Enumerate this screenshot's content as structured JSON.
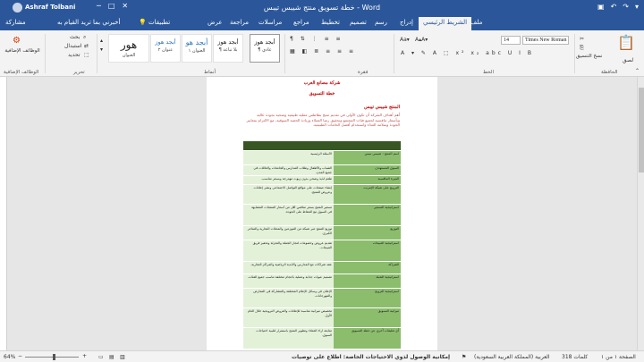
{
  "window": {
    "title": "خطة تسويق منتج شيبس تيبس - Word",
    "user": "Ashraf Tolbani",
    "share_label": "مشاركة",
    "tell_me": "أخبرني بما تريد القيام به"
  },
  "tabs": [
    "ملف",
    "الشريط الرئيسي",
    "إدراج",
    "رسم",
    "تصميم",
    "تخطيط",
    "مراجع",
    "مراسلات",
    "مراجعة",
    "عرض",
    "تطبيقات"
  ],
  "ribbon": {
    "clipboard": {
      "paste_label": "لصق",
      "format_painter": "نسخ التنسيق",
      "group_label": "الحافظة"
    },
    "font": {
      "name": "Times New Roman",
      "size": "14",
      "group_label": "الخط"
    },
    "paragraph": {
      "group_label": "فقرة"
    },
    "styles": {
      "group_label": "أنماط",
      "items": [
        {
          "sample": "أبجد هوز",
          "label": "¶ عادي"
        },
        {
          "sample": "أبجد هوز",
          "label": "¶ بلا تباعد"
        },
        {
          "sample": "أبجد هو",
          "label": "العنوان ١"
        },
        {
          "sample": "أبجد هوز",
          "label": "عنوان ٢"
        },
        {
          "sample": "هور",
          "label": "العنوان"
        }
      ]
    },
    "editing": {
      "find": "بحث",
      "replace": "استبدال",
      "select": "تحديد",
      "group_label": "تحرير"
    },
    "addins": {
      "label": "الوظائف الإضافية",
      "group_label": "الوظائف الإضافية"
    }
  },
  "document": {
    "main_title": "شركة مصانع العرب",
    "subtitle": "خطة التسويق",
    "section": "المنتج شيبس تيبس",
    "paragraph": "أهم أهداف الشركة أن تكون الأولى في تقديم منتج بطاطس مقلية طبيعية وصحية بجودة عالية وبأسعار تنافسية لجميع فئات المجتمع وتحقيق رضا العملاء وزيادة الحصة السوقية، مع الالتزام بمعايير الجودة وسلامة الغذاء واستخدام أفضل الخامات الطبيعية.",
    "table": {
      "header_left": "",
      "header_right": "",
      "rows": [
        {
          "right": "اسم المنتج : شيبس تيبس",
          "left": "الأسئلة الرئيسية"
        },
        {
          "right": "السوق المستهدف",
          "left": "الشباب والأطفال وطلاب المدارس والجامعات والعائلات في جميع المدن."
        },
        {
          "right": "الميزة التنافسية",
          "left": "طعم لذيذ وصحي بدون زيوت مهدرجة وبسعر مناسب."
        },
        {
          "right": "الترويج على شبكة الإنترنت",
          "left": "إنشاء صفحات على مواقع التواصل الاجتماعي ونشر إعلانات وعروض للمنتج."
        },
        {
          "right": "استراتيجية التسعير",
          "left": "تسعير المنتج بسعر منافس أقل من أسعار المنتجات المشابهة في السوق مع الحفاظ على الجودة."
        },
        {
          "right": "التوزيع",
          "left": "توزيع المنتج عبر شبكة من الموزعين والمحلات التجارية والمتاجر الكبرى."
        },
        {
          "right": "استراتيجية المبيعات",
          "left": "تقديم عروض وخصومات لتجار الجملة والتجزئة وتحفيز فريق المبيعات."
        },
        {
          "right": "الشراكة",
          "left": "عقد شراكات مع المدارس والأندية الرياضية والمراكز التجارية."
        },
        {
          "right": "استراتيجية التعبئة",
          "left": "تصميم عبوات جذابة وعملية بأحجام مختلفة تناسب جميع الفئات."
        },
        {
          "right": "استراتيجية الترويج",
          "left": "الإعلان في وسائل الإعلام المختلفة والمشاركة في المعارض والمهرجانات."
        },
        {
          "right": "ميزانية التسويق",
          "left": "تخصيص ميزانية مناسبة للإعلانات والعروض الترويجية خلال العام الأول."
        },
        {
          "right": "أي تعليقات أخرى عن خطة التسويق",
          "left": "متابعة آراء العملاء وتطوير المنتج باستمرار لتلبية احتياجات السوق."
        }
      ]
    }
  },
  "status": {
    "page": "الصفحة ١ من ١",
    "words": "318 كلمات",
    "language": "العربية (المملكة العربية السعودية)",
    "accessibility": "إمكانية الوصول لذوي الاحتياجات الخاصة: اطلاع على توصيات",
    "zoom": "64%",
    "zoom_level": 0.64
  }
}
